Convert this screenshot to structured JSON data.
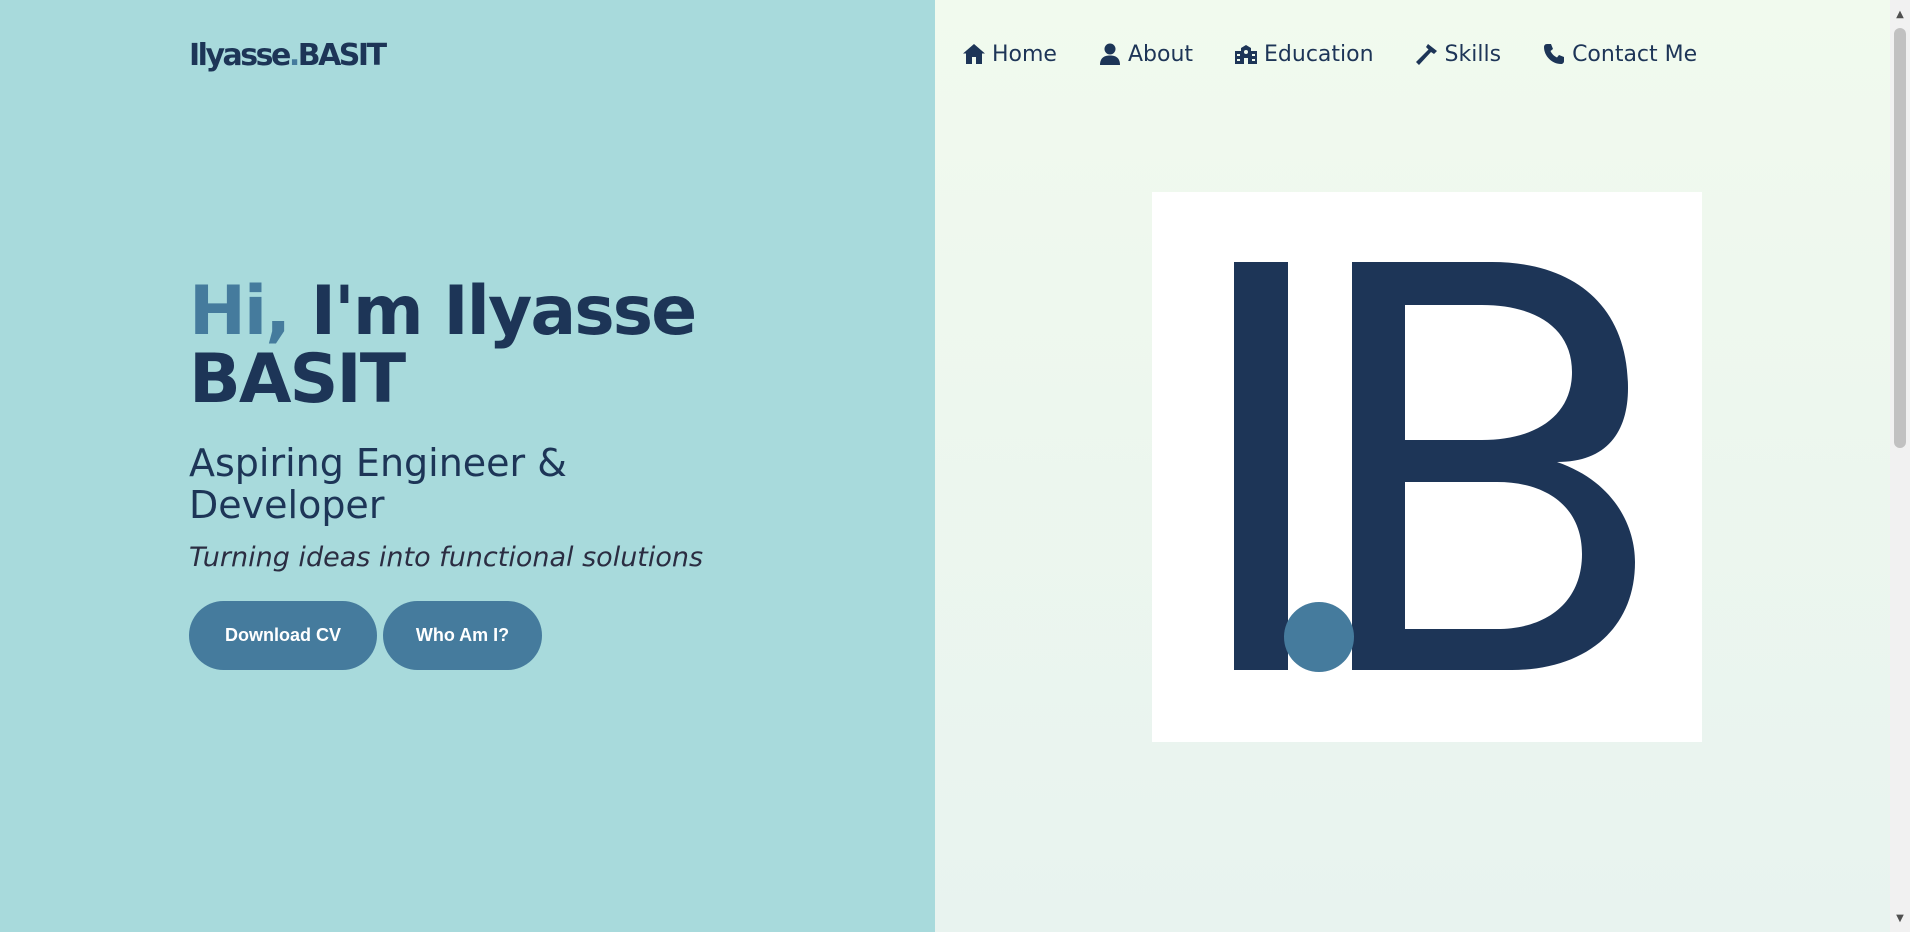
{
  "logo": {
    "first": "Ilyasse",
    "dot": ".",
    "last": "BASIT"
  },
  "nav": {
    "items": [
      {
        "label": "Home",
        "icon": "home-icon"
      },
      {
        "label": "About",
        "icon": "user-icon"
      },
      {
        "label": "Education",
        "icon": "school-icon"
      },
      {
        "label": "Skills",
        "icon": "hammer-icon"
      },
      {
        "label": "Contact Me",
        "icon": "phone-icon"
      }
    ]
  },
  "hero": {
    "hi": "Hi,",
    "name": " I'm Ilyasse BASIT",
    "subtitle": "Aspiring Engineer & Developer",
    "tagline": "Turning ideas into functional solutions",
    "buttons": {
      "cv": "Download CV",
      "who": "Who Am I?"
    }
  },
  "colors": {
    "accent": "#457b9d",
    "primary": "#1d3557",
    "left_bg": "#a8dadc",
    "right_bg": "#f1faee"
  }
}
